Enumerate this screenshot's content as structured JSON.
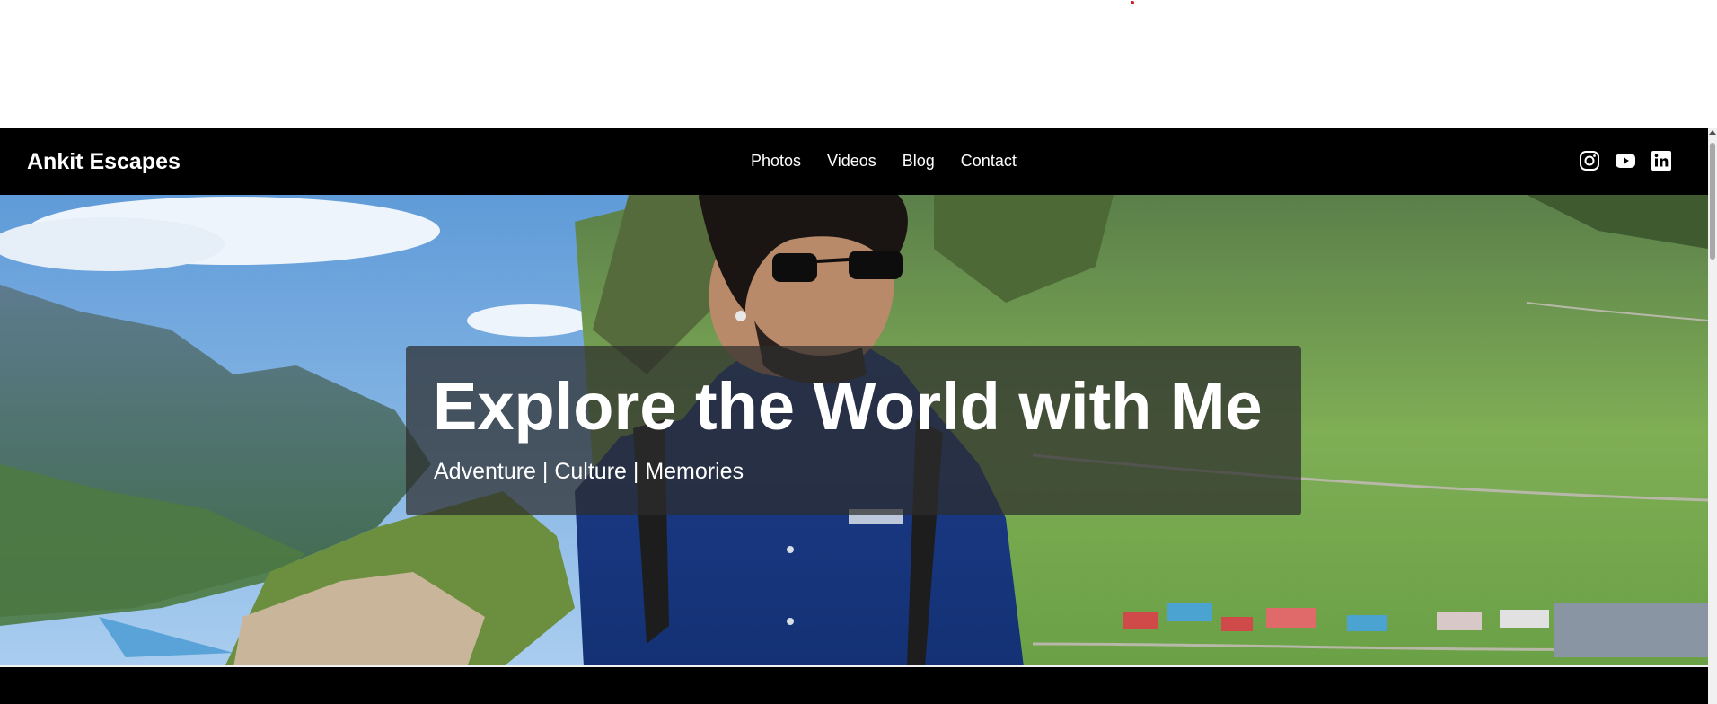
{
  "nav": {
    "brand": "Ankit Escapes",
    "links": [
      "Photos",
      "Videos",
      "Blog",
      "Contact"
    ],
    "social_icons": [
      "instagram-icon",
      "youtube-icon",
      "linkedin-icon"
    ]
  },
  "hero": {
    "title": "Explore the World with Me",
    "subtitle": "Adventure | Culture | Memories"
  },
  "colors": {
    "nav_background": "#000000",
    "text": "#ffffff",
    "overlay": "rgba(45,45,45,0.72)"
  }
}
